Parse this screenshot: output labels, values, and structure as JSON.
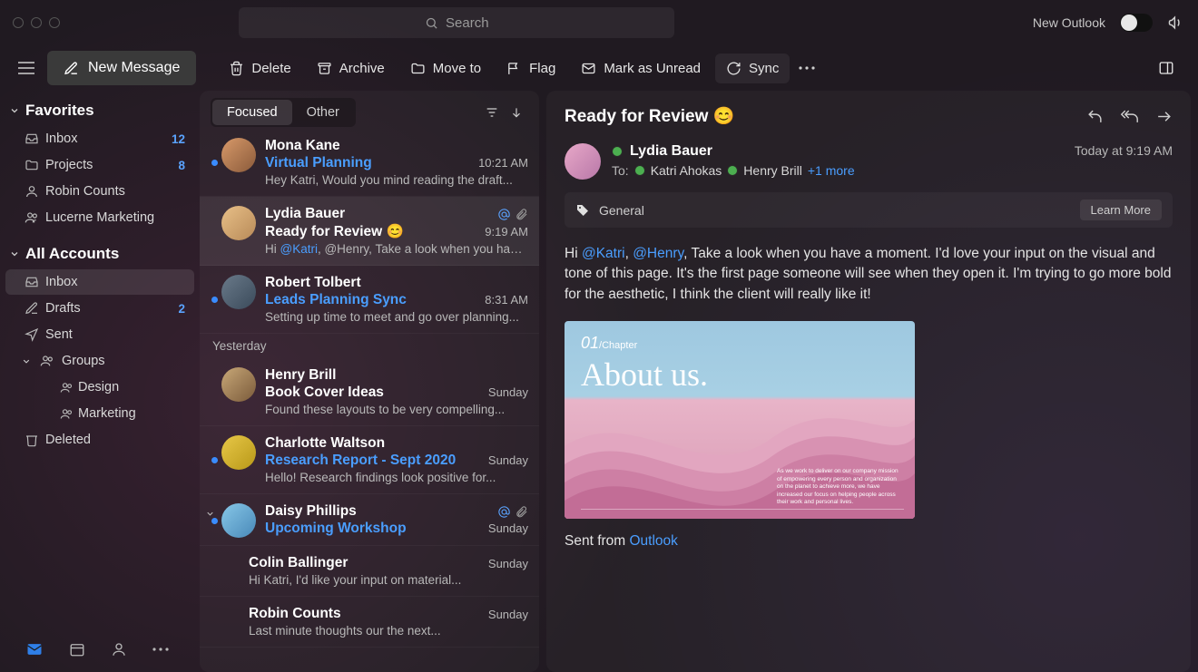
{
  "titlebar": {
    "search_placeholder": "Search",
    "new_outlook": "New Outlook"
  },
  "toolbar": {
    "new_message": "New Message",
    "delete": "Delete",
    "archive": "Archive",
    "move_to": "Move to",
    "flag": "Flag",
    "mark_unread": "Mark as Unread",
    "sync": "Sync"
  },
  "sidebar": {
    "favorites_label": "Favorites",
    "favorites": [
      {
        "label": "Inbox",
        "badge": "12",
        "icon": "inbox"
      },
      {
        "label": "Projects",
        "badge": "8",
        "icon": "folder"
      },
      {
        "label": "Robin Counts",
        "icon": "person"
      },
      {
        "label": "Lucerne Marketing",
        "icon": "group"
      }
    ],
    "all_accounts_label": "All Accounts",
    "accounts": [
      {
        "label": "Inbox",
        "icon": "inbox",
        "selected": true
      },
      {
        "label": "Drafts",
        "badge": "2",
        "icon": "drafts"
      },
      {
        "label": "Sent",
        "icon": "sent"
      }
    ],
    "groups_label": "Groups",
    "groups": [
      {
        "label": "Design",
        "icon": "group"
      },
      {
        "label": "Marketing",
        "icon": "group"
      }
    ],
    "deleted_label": "Deleted"
  },
  "list": {
    "tabs": {
      "focused": "Focused",
      "other": "Other"
    },
    "yesterday": "Yesterday",
    "items": [
      {
        "sender": "Mona Kane",
        "subject": "Virtual Planning",
        "time": "10:21 AM",
        "preview": "Hey Katri, Would you mind reading the draft...",
        "unread": true,
        "avatar": "av1",
        "mention": false,
        "attach": false
      },
      {
        "sender": "Lydia Bauer",
        "subject": "Ready for Review 😊",
        "time": "9:19 AM",
        "preview_pre": "Hi ",
        "preview_mention": "@Katri",
        "preview_post": ", @Henry, Take a look when you have...",
        "unread": false,
        "avatar": "av2",
        "mention": true,
        "attach": true,
        "selected": true
      },
      {
        "sender": "Robert Tolbert",
        "subject": "Leads Planning Sync",
        "time": "8:31 AM",
        "preview": "Setting up time to meet and go over planning...",
        "unread": true,
        "avatar": "av3",
        "mention": false,
        "attach": false
      },
      {
        "sender": "Henry Brill",
        "subject": "Book Cover Ideas",
        "time": "Sunday",
        "preview": "Found these layouts to be very compelling...",
        "unread": false,
        "avatar": "av4",
        "mention": false,
        "attach": false
      },
      {
        "sender": "Charlotte Waltson",
        "subject": "Research Report - Sept 2020",
        "time": "Sunday",
        "preview": "Hello! Research findings look positive for...",
        "unread": true,
        "avatar": "av5",
        "mention": false,
        "attach": false
      },
      {
        "sender": "Daisy Phillips",
        "subject": "Upcoming Workshop",
        "time": "Sunday",
        "unread": true,
        "avatar": "av6",
        "mention": true,
        "attach": true,
        "thread": true
      },
      {
        "sender": "Colin Ballinger",
        "time": "Sunday",
        "preview": "Hi Katri, I'd like your input on material...",
        "child": true
      },
      {
        "sender": "Robin Counts",
        "time": "Sunday",
        "preview": "Last minute thoughts our the next...",
        "child": true
      }
    ]
  },
  "reader": {
    "subject": "Ready for Review 😊",
    "from": "Lydia Bauer",
    "to_label": "To:",
    "to": [
      "Katri Ahokas",
      "Henry Brill"
    ],
    "more": "+1 more",
    "timestamp": "Today at 9:19 AM",
    "tag": "General",
    "learn_more": "Learn More",
    "body_pre": "Hi ",
    "m1": "@Katri",
    "body_mid1": ", ",
    "m2": "@Henry",
    "body_post": ", Take a look when you have a moment. I'd love your input on the visual and tone of this page. It's the first page someone will see when they open it. I'm trying to go more bold for the aesthetic, I think the client will really like it!",
    "image": {
      "chapter_num": "01",
      "chapter": "Chapter",
      "title": "About us."
    },
    "sig_pre": "Sent from ",
    "sig_link": "Outlook"
  }
}
